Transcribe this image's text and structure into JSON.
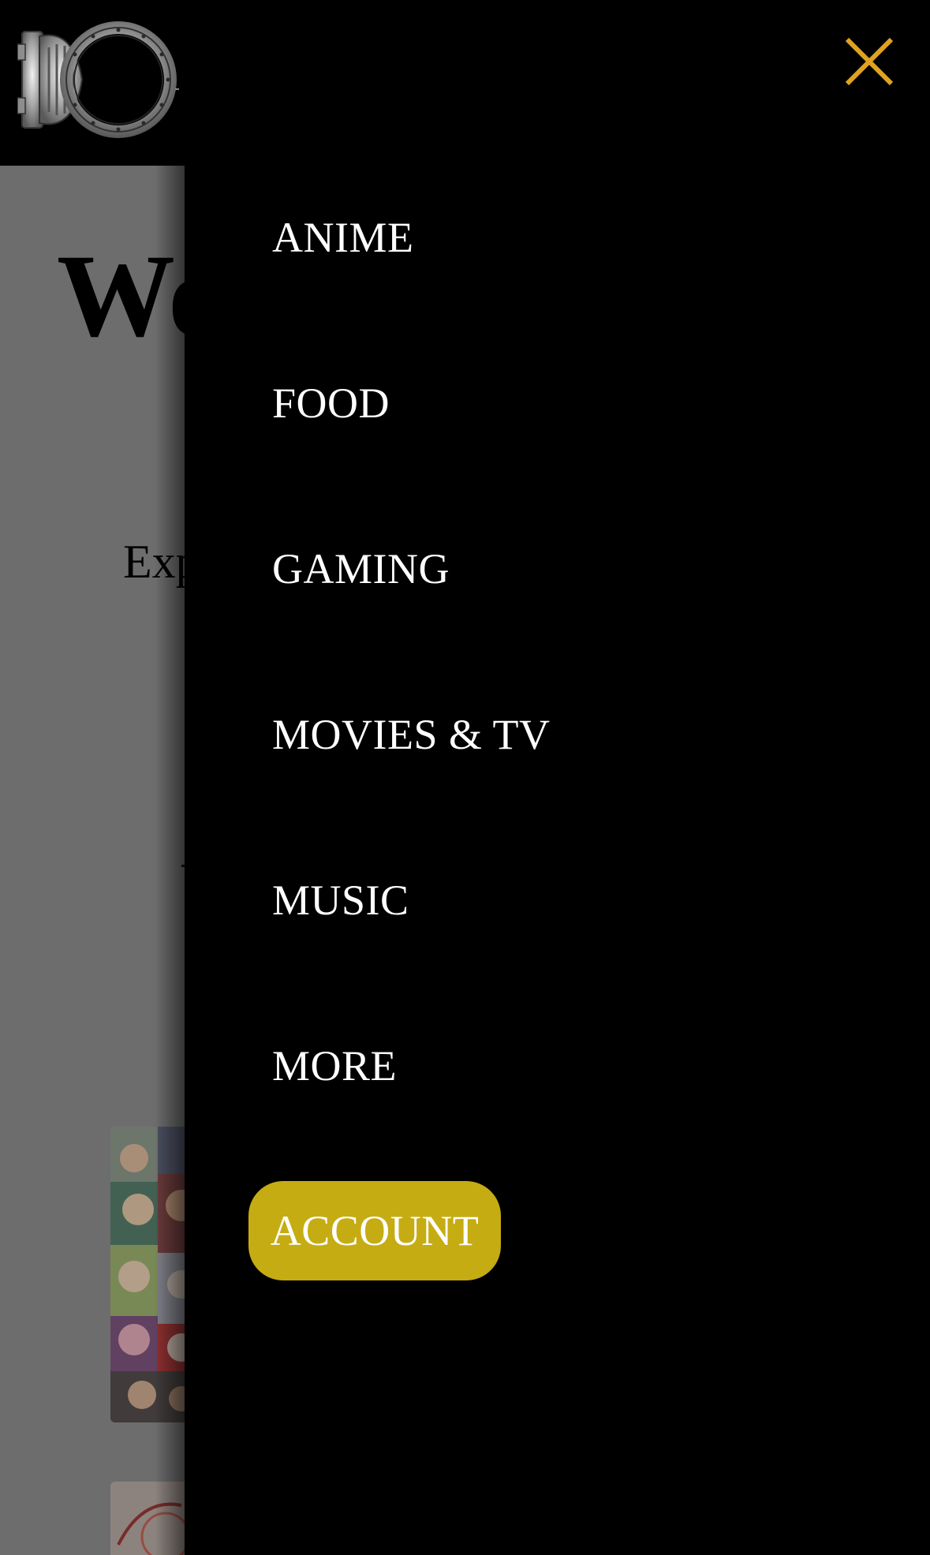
{
  "page": {
    "title_partial": "We",
    "subtitle_partial": "Exp"
  },
  "header": {
    "logo_icon": "vault-door-logo-icon"
  },
  "drawer": {
    "close_icon": "close-icon",
    "close_color": "#e0a21f",
    "items": [
      {
        "label": "ANIME"
      },
      {
        "label": "FOOD"
      },
      {
        "label": "GAMING"
      },
      {
        "label": "MOVIES & TV"
      },
      {
        "label": "MUSIC"
      },
      {
        "label": "MORE"
      }
    ],
    "account": {
      "label": "ACCOUNT",
      "color": "#c6ac13"
    }
  },
  "colors": {
    "overlay_gray": "#6d6d6d",
    "drawer_bg": "#000000",
    "menu_text": "#ffffff"
  }
}
